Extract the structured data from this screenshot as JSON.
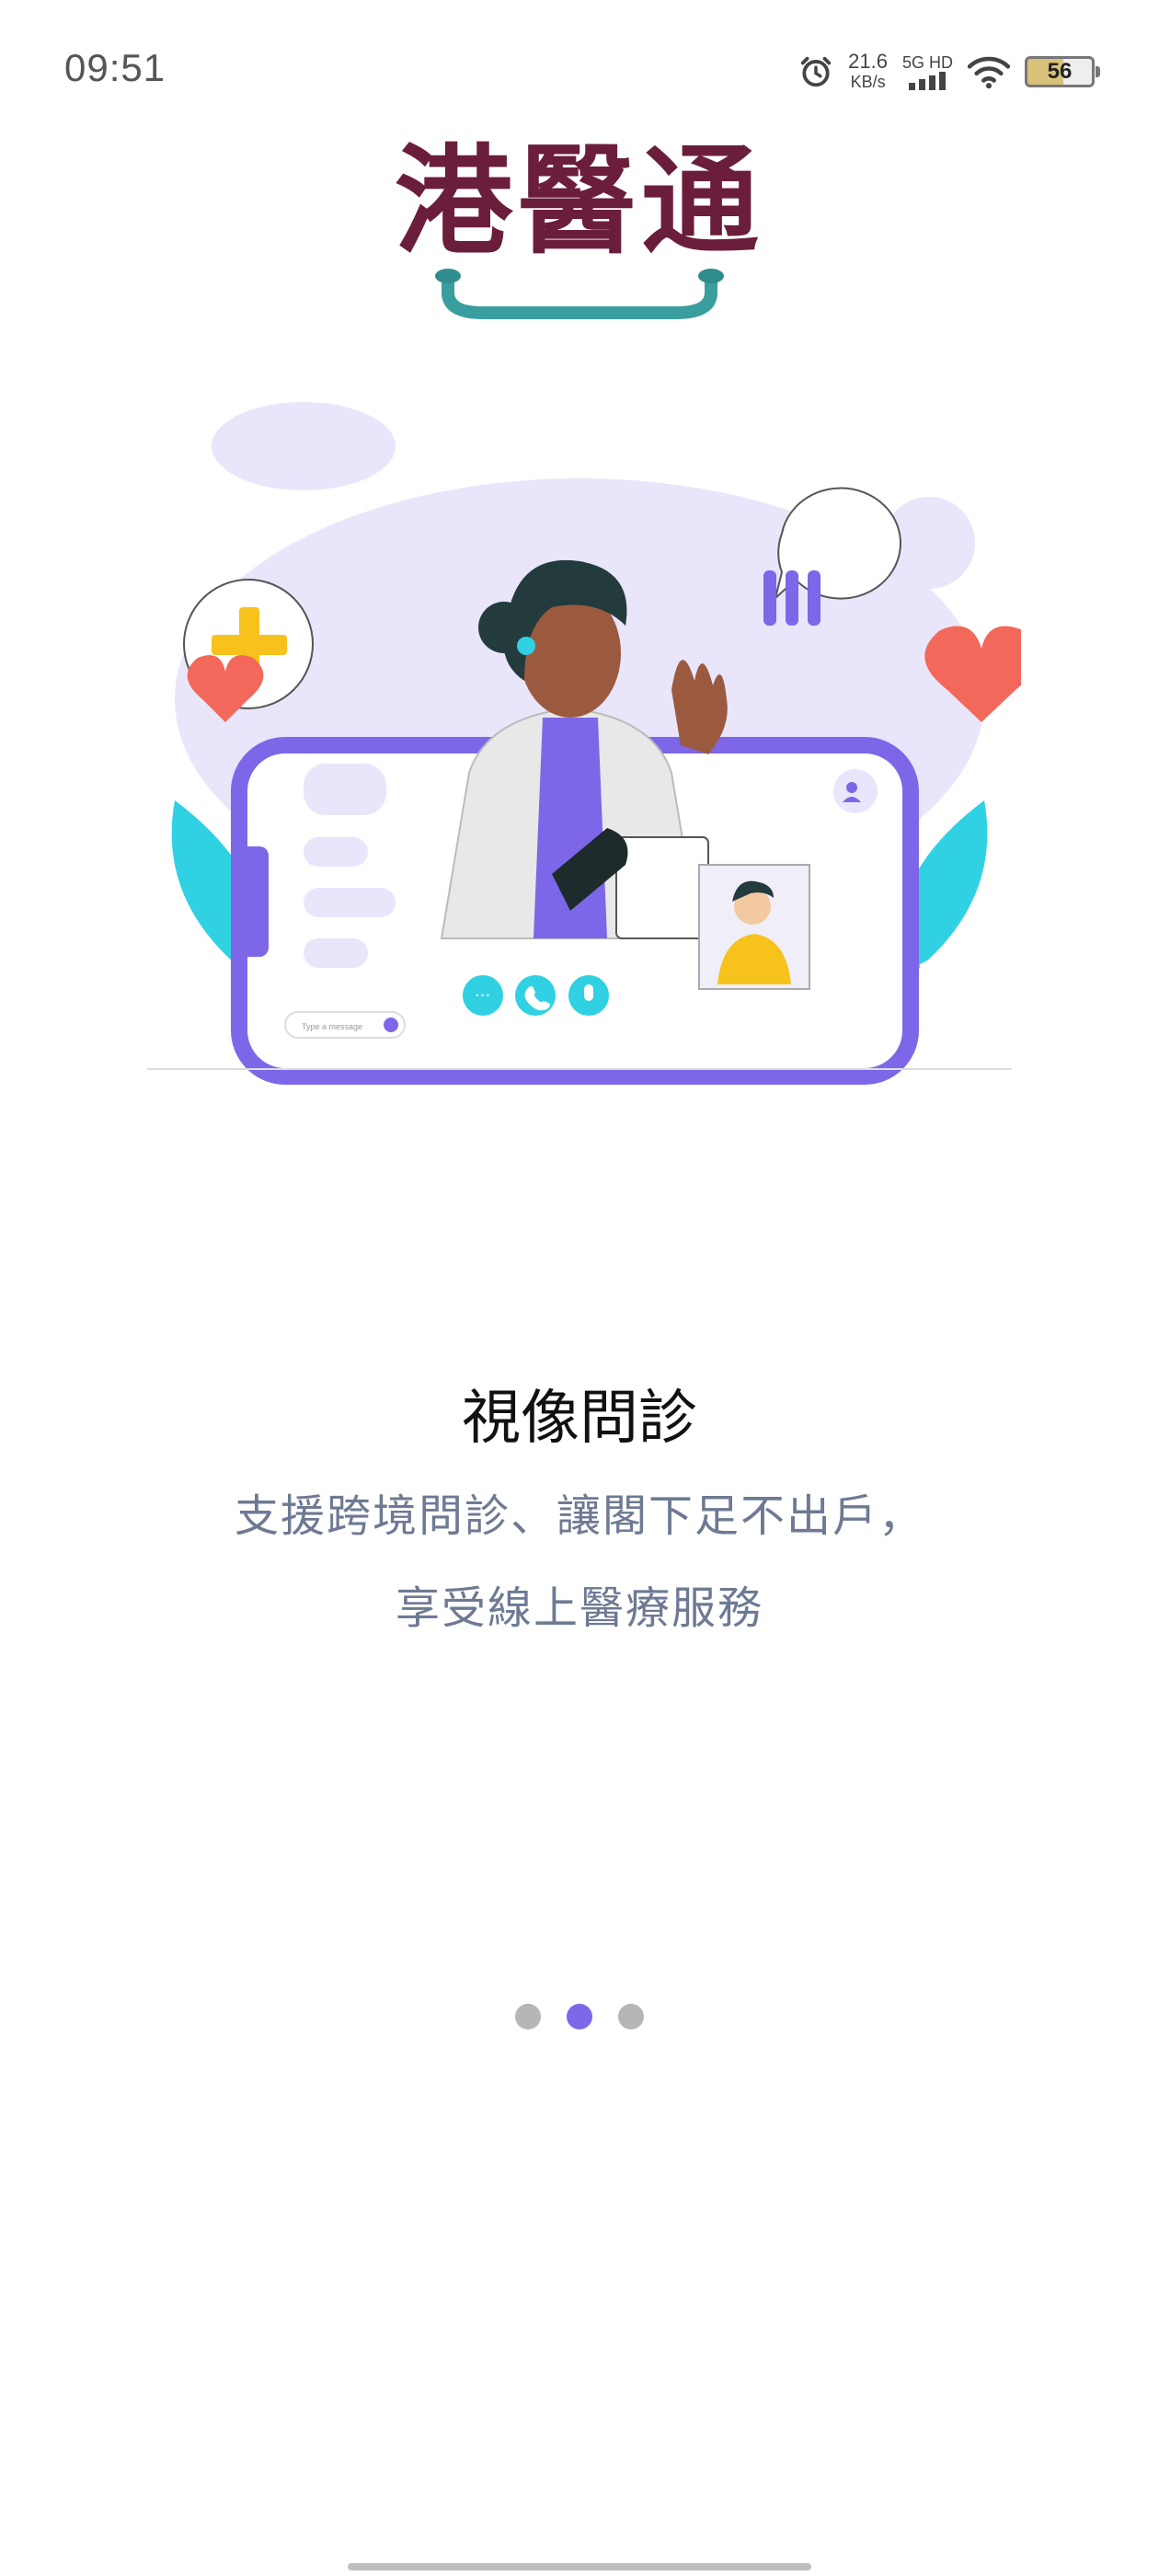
{
  "status_bar": {
    "time": "09:51",
    "speed_value": "21.6",
    "speed_unit": "KB/s",
    "network_top": "5G HD",
    "battery": "56",
    "icons": [
      "alarm-icon",
      "signal-icon",
      "wifi-icon",
      "battery-icon"
    ]
  },
  "logo": {
    "text": "港醫通"
  },
  "illustration": {
    "description_icons": [
      "doctor-illustration",
      "video-call-phone",
      "heart-icon",
      "plus-icon",
      "chart-bubble-icon"
    ],
    "chat_input_placeholder": "Type a message",
    "colors": {
      "primary": "#7d67e8",
      "accent_cyan": "#2fd1e3",
      "heart": "#f2685a",
      "plus": "#f7c21b"
    }
  },
  "onboarding": {
    "title": "視像問診",
    "subtitle_line1": "支援跨境問診、讓閣下足不出戶，",
    "subtitle_line2": "享受線上醫療服務"
  },
  "pager": {
    "total": 3,
    "active": 2
  },
  "colors": {
    "logo": "#6b1d3c",
    "smile": "#3a9e9e",
    "subtitle": "#6e7a93",
    "active_dot": "#7d67e8",
    "inactive_dot": "#b6b6b6"
  }
}
